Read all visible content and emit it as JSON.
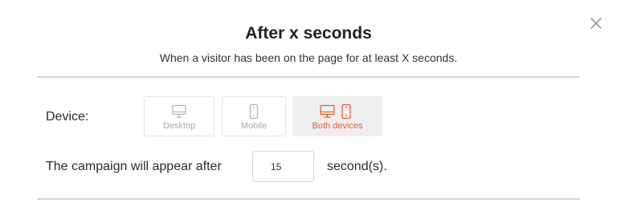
{
  "modal": {
    "title": "After x seconds",
    "subtitle": "When a visitor has been on the page for at least X seconds.",
    "close_icon": "close-icon"
  },
  "device": {
    "label": "Device:",
    "selected": "Both devices",
    "options": [
      {
        "label": "Desktop",
        "icon": "desktop-icon",
        "selected": false
      },
      {
        "label": "Mobile",
        "icon": "mobile-icon",
        "selected": false
      },
      {
        "label": "Both devices",
        "icon": "desktop-mobile-icon",
        "selected": true
      }
    ]
  },
  "timing": {
    "prefix": "The campaign will appear after",
    "value": "15",
    "suffix": "second(s)."
  },
  "colors": {
    "accent": "#e0602f",
    "inactive_icon": "#b5b5b5",
    "divider": "#d6d6d6"
  }
}
